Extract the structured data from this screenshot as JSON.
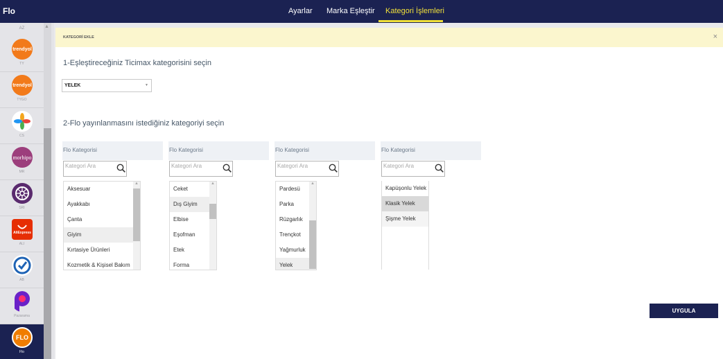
{
  "app": {
    "brand": "Flo"
  },
  "nav": {
    "items": [
      "Ayarlar",
      "Marka Eşleştir",
      "Kategori İşlemleri"
    ],
    "active_index": 2
  },
  "sidebar": {
    "top_label": "AZ",
    "marketplaces": [
      {
        "label": "TY",
        "logo_text": "trendyol",
        "color": "#f27a1a"
      },
      {
        "label": "TYGO",
        "logo_text": "trendyol",
        "color": "#f27a1a"
      },
      {
        "label": "CS",
        "logo_text": "",
        "color": "#ffffff"
      },
      {
        "label": "MR",
        "logo_text": "morhipo",
        "color": "#9c3e7c"
      },
      {
        "label": "SRI",
        "logo_text": "",
        "color": "#5a2a6e"
      },
      {
        "label": "ALI",
        "logo_text": "AliExpress",
        "color": "#e62e04"
      },
      {
        "label": "AB",
        "logo_text": "",
        "color": "#1e63b5"
      },
      {
        "label": "Pazarama",
        "logo_text": "",
        "color": "#ffffff"
      },
      {
        "label": "Flo",
        "logo_text": "FLO",
        "color": "#f07d00",
        "active": true
      }
    ]
  },
  "panel": {
    "title": "KATEGORİ EKLE",
    "step1_label": "1-Eşleştireceğiniz Ticimax kategorisini seçin",
    "ticimax_category": "YELEK",
    "step2_label": "2-Flo yayınlanmasını istediğiniz kategoriyi seçin",
    "columns": [
      {
        "header": "Flo Kategorisi",
        "search_placeholder": "Kategori Ara",
        "items": [
          "Aksesuar",
          "Ayakkabı",
          "Çanta",
          "Giyim",
          "Kırtasiye Ürünleri",
          "Kozmetik & Kişisel Bakım"
        ],
        "highlighted": 3
      },
      {
        "header": "Flo Kategorisi",
        "search_placeholder": "Kategori Ara",
        "items": [
          "Ceket",
          "Dış Giyim",
          "Elbise",
          "Eşofman",
          "Etek",
          "Forma"
        ],
        "highlighted": 1
      },
      {
        "header": "Flo Kategorisi",
        "search_placeholder": "Kategori Ara",
        "items": [
          "Pardesü",
          "Parka",
          "Rüzgarlık",
          "Trençkot",
          "Yağmurluk",
          "Yelek"
        ],
        "highlighted": 5
      },
      {
        "header": "Flo Kategorisi",
        "search_placeholder": "Kategori Ara",
        "items": [
          "Kapüşonlu Yelek",
          "Klasik Yelek",
          "Şişme Yelek"
        ],
        "highlighted": 1
      }
    ],
    "apply_label": "UYGULA"
  }
}
